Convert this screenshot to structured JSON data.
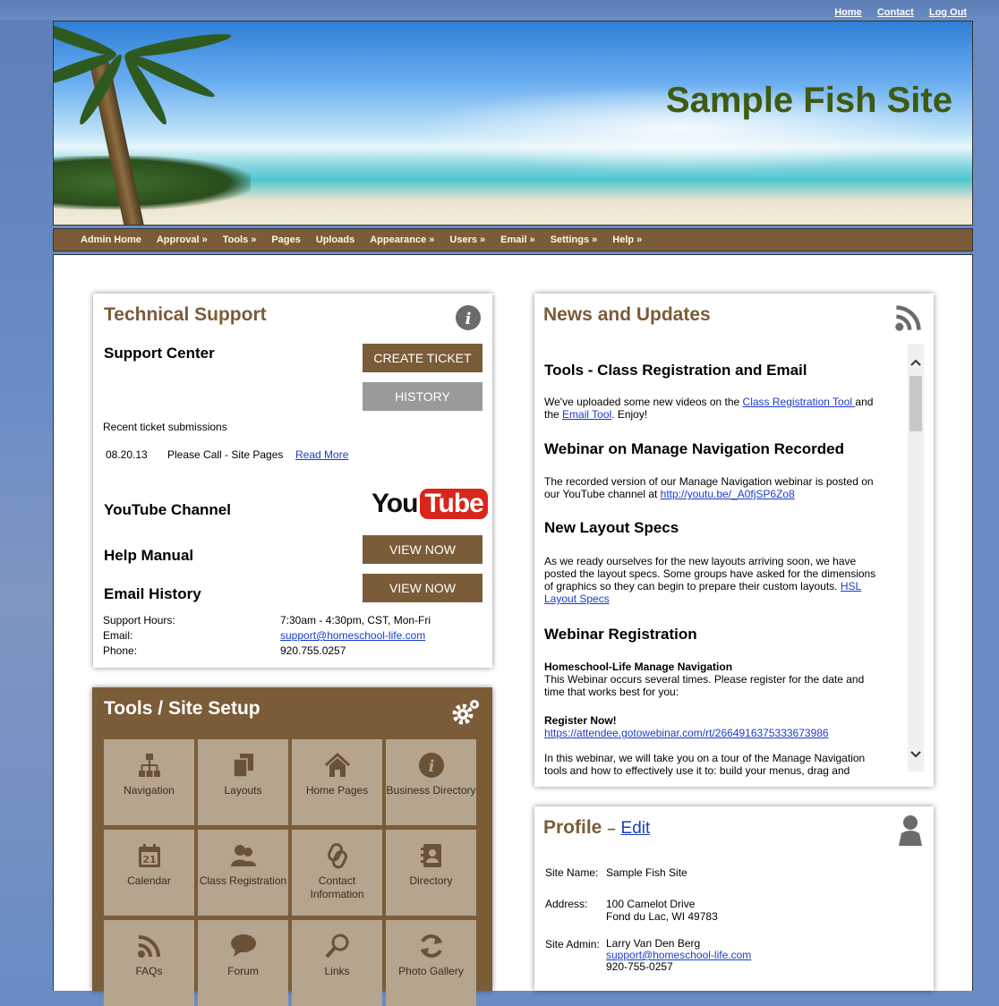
{
  "toplinks": {
    "home": "Home",
    "contact": "Contact",
    "logout": "Log Out"
  },
  "site": {
    "title": "Sample Fish Site"
  },
  "nav": [
    "Admin Home",
    "Approval »",
    "Tools »",
    "Pages",
    "Uploads",
    "Appearance »",
    "Users »",
    "Email »",
    "Settings »",
    "Help »"
  ],
  "support": {
    "title": "Technical Support",
    "support_center": "Support Center",
    "create_ticket": "CREATE TICKET",
    "history": "HISTORY",
    "recent": "Recent ticket submissions",
    "ticket_date": "08.20.13",
    "ticket_text": "Please Call - Site Pages",
    "read_more": "Read More",
    "youtube": "YouTube Channel",
    "youtube_logo_you": "You",
    "youtube_logo_tube": "Tube",
    "help_manual": "Help Manual",
    "view_now": "VIEW NOW",
    "email_history": "Email History",
    "view_now2": "VIEW NOW",
    "hours_label": "Support Hours:",
    "hours_value": "7:30am - 4:30pm, CST, Mon-Fri",
    "email_label": "Email:",
    "email_value": "support@homeschool-life.com",
    "phone_label": "Phone:",
    "phone_value": "920.755.0257"
  },
  "tools": {
    "title": "Tools / Site Setup",
    "tiles": [
      {
        "label": "Navigation",
        "icon": "sitemap-icon"
      },
      {
        "label": "Layouts",
        "icon": "copy-icon"
      },
      {
        "label": "Home Pages",
        "icon": "home-icon"
      },
      {
        "label": "Business Directory",
        "icon": "info-icon"
      },
      {
        "label": "Calendar",
        "icon": "calendar-icon"
      },
      {
        "label": "Class Registration",
        "icon": "users-icon"
      },
      {
        "label": "Contact Information",
        "icon": "link-icon"
      },
      {
        "label": "Directory",
        "icon": "address-book-icon"
      },
      {
        "label": "FAQs",
        "icon": "rss-icon"
      },
      {
        "label": "Forum",
        "icon": "chat-bubble-icon"
      },
      {
        "label": "Links",
        "icon": "search-icon"
      },
      {
        "label": "Photo Gallery",
        "icon": "refresh-icon"
      }
    ]
  },
  "news": {
    "title": "News and Updates",
    "h1": "Tools - Class Registration and Email",
    "p1_a": "We've uploaded some new videos on the ",
    "p1_link1": "Class Registration Tool ",
    "p1_b": "and",
    "p1_c": "the ",
    "p1_link2": "Email Tool",
    "p1_d": ".  Enjoy!",
    "h2": "Webinar on Manage Navigation Recorded",
    "p2_a": "The recorded version of our Manage Navigation webinar is posted on",
    "p2_b": "our YouTube channel at ",
    "p2_link": "http://youtu.be/_A0fjSP6Zo8",
    "h3": "New Layout Specs",
    "p3_1": "As we ready ourselves for the new layouts arriving soon, we have",
    "p3_2": "posted the layout specs.  Some groups have asked for the dimensions",
    "p3_3": "of graphics so they can begin to prepare their custom layouts.  ",
    "p3_link1": "HSL",
    "p3_link2": "Layout Specs",
    "h4": "Webinar Registration",
    "p4_bold": "Homeschool-Life Manage Navigation",
    "p4_1": "This Webinar occurs several times. Please register for the date and",
    "p4_2": "time that works best for you:",
    "p5_bold": "Register Now!",
    "p5_link": "https://attendee.gotowebinar.com/rt/2664916375333673986",
    "p6_1": "In this webinar, we will take you on a tour of the Manage Navigation",
    "p6_2": "tools and how to effectively use it to:  build your menus, drag and"
  },
  "profile": {
    "title": "Profile",
    "dash": "–",
    "edit": "Edit",
    "site_name_label": "Site Name:",
    "site_name": "Sample Fish Site",
    "address_label": "Address:",
    "address_1": "100 Camelot Drive",
    "address_2": "Fond du Lac, WI 49783",
    "admin_label": "Site Admin:",
    "admin_name": "Larry Van Den Berg",
    "admin_email": "support@homeschool-life.com",
    "admin_phone": "920-755-0257"
  }
}
